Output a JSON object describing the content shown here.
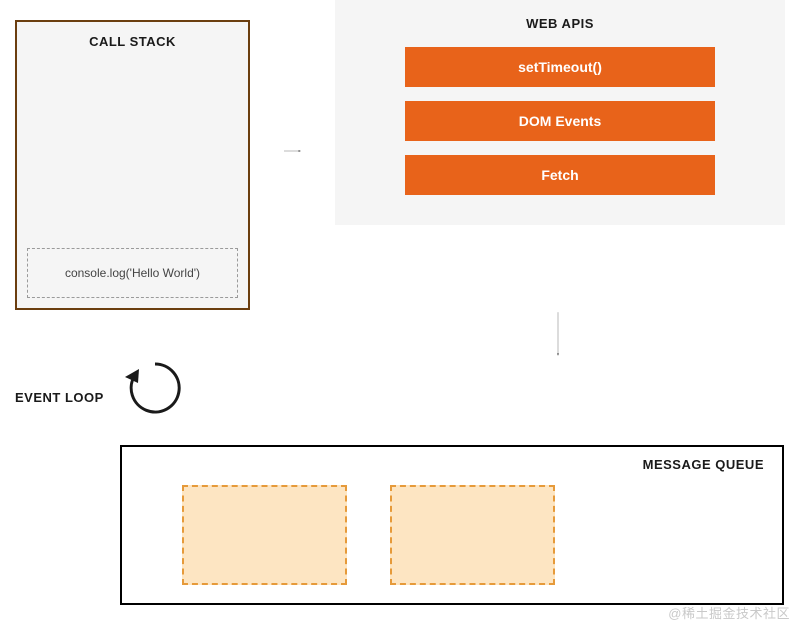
{
  "call_stack": {
    "title": "CALL STACK",
    "frame": "console.log('Hello World')"
  },
  "web_apis": {
    "title": "WEB APIS",
    "items": {
      "0": "setTimeout()",
      "1": "DOM Events",
      "2": "Fetch"
    }
  },
  "event_loop": {
    "label": "EVENT LOOP"
  },
  "message_queue": {
    "title": "MESSAGE QUEUE"
  },
  "watermark": "@稀土掘金技术社区"
}
